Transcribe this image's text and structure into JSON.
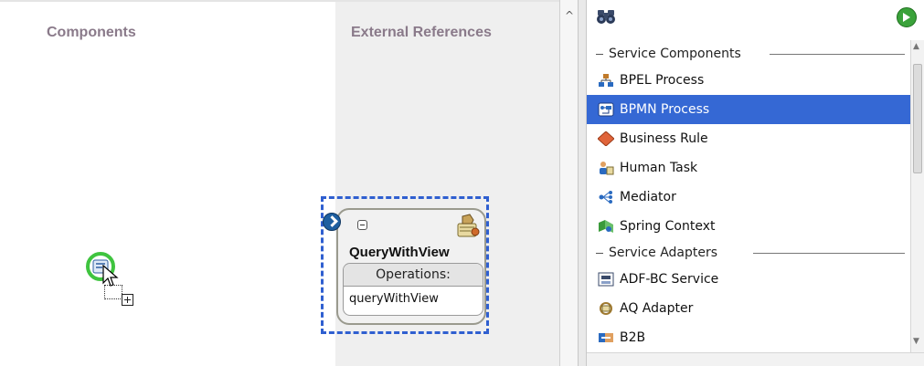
{
  "canvas": {
    "components_title": "Components",
    "external_title": "External References"
  },
  "reference_card": {
    "name": "QueryWithView",
    "operations_header": "Operations:",
    "operations": [
      "queryWithView"
    ]
  },
  "palette": {
    "sections": [
      {
        "title": "Service Components",
        "items": [
          {
            "label": "BPEL Process",
            "icon": "bpel-process-icon",
            "selected": false
          },
          {
            "label": "BPMN Process",
            "icon": "bpmn-process-icon",
            "selected": true
          },
          {
            "label": "Business Rule",
            "icon": "business-rule-icon",
            "selected": false
          },
          {
            "label": "Human Task",
            "icon": "human-task-icon",
            "selected": false
          },
          {
            "label": "Mediator",
            "icon": "mediator-icon",
            "selected": false
          },
          {
            "label": "Spring Context",
            "icon": "spring-context-icon",
            "selected": false
          }
        ]
      },
      {
        "title": "Service Adapters",
        "items": [
          {
            "label": "ADF-BC Service",
            "icon": "adf-bc-service-icon",
            "selected": false
          },
          {
            "label": "AQ Adapter",
            "icon": "aq-adapter-icon",
            "selected": false
          },
          {
            "label": "B2B",
            "icon": "b2b-icon",
            "selected": false
          }
        ]
      }
    ],
    "toolbar_icons": [
      "binoculars-icon",
      "add-icon"
    ]
  },
  "colors": {
    "selection": "#3568d4",
    "drag_highlight": "#3fc43f",
    "reference_border": "#2f5fd0",
    "column_title": "#8a7a8a"
  }
}
